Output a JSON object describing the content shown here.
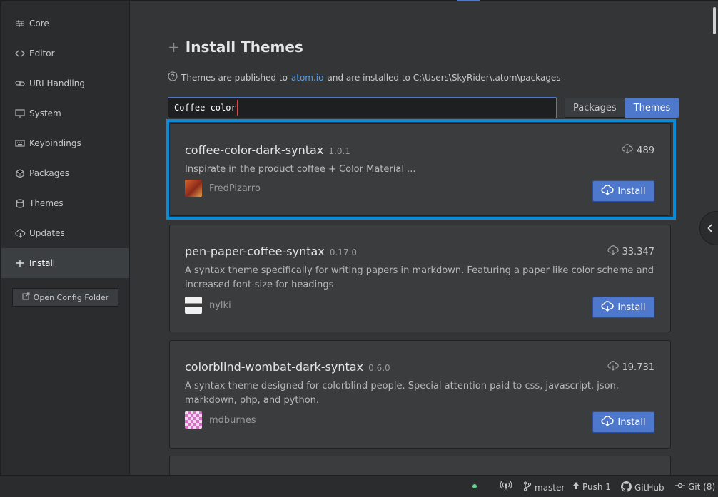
{
  "sidebar": {
    "items": [
      {
        "label": "Core",
        "icon": "sliders-icon"
      },
      {
        "label": "Editor",
        "icon": "code-icon"
      },
      {
        "label": "URI Handling",
        "icon": "link-icon"
      },
      {
        "label": "System",
        "icon": "monitor-icon"
      },
      {
        "label": "Keybindings",
        "icon": "keyboard-icon"
      },
      {
        "label": "Packages",
        "icon": "package-icon"
      },
      {
        "label": "Themes",
        "icon": "paintcan-icon"
      },
      {
        "label": "Updates",
        "icon": "cloud-download-icon"
      },
      {
        "label": "Install",
        "icon": "plus-icon",
        "active": true
      }
    ],
    "open_config_label": "Open Config Folder"
  },
  "main": {
    "title": "Install Themes",
    "info_prefix": "Themes are published to",
    "info_link": "atom.io",
    "info_suffix": "and are installed to C:\\Users\\SkyRider\\.atom\\packages",
    "search_value": "Coffee-color",
    "toggle": {
      "packages_label": "Packages",
      "themes_label": "Themes",
      "selected": "Themes"
    },
    "results": [
      {
        "name": "coffee-color-dark-syntax",
        "version": "1.0.1",
        "downloads": "489",
        "description": "Inspirate in the product coffee + Color Material ...",
        "author": "FredPizarro",
        "install_label": "Install"
      },
      {
        "name": "pen-paper-coffee-syntax",
        "version": "0.17.0",
        "downloads": "33.347",
        "description": "A syntax theme specifically for writing papers in markdown. Featuring a paper like color scheme and increased font-size for headings",
        "author": "nylki",
        "install_label": "Install"
      },
      {
        "name": "colorblind-wombat-dark-syntax",
        "version": "0.6.0",
        "downloads": "19.731",
        "description": "A syntax theme designed for colorblind people. Special attention paid to css, javascript, json, markdown, php, and python.",
        "author": "mdburnes",
        "install_label": "Install"
      }
    ]
  },
  "statusbar": {
    "branch": "master",
    "push": "Push 1",
    "github": "GitHub",
    "git": "Git (8)"
  },
  "colors": {
    "accent": "#4d78cc",
    "highlight": "#0b8bd6",
    "link": "#5a9ee6"
  }
}
